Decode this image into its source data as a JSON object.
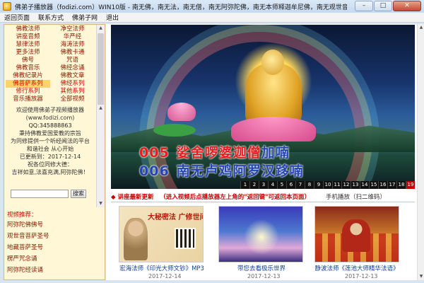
{
  "window": {
    "title": "佛弟子播放器（fodizi.com）WIN10版 - 南无佛，南无法，南无僧，南无阿弥陀佛，南无本师释迦牟尼佛，南无观世音菩萨！",
    "minimize": "–",
    "maximize": "□",
    "close": "✕"
  },
  "menu": [
    "返回页面",
    "联系方式",
    "佛弟子网",
    "退出"
  ],
  "categories": [
    [
      "佛教法师",
      "净空法师"
    ],
    [
      "讲座音频",
      "华严经"
    ],
    [
      "慧律法师",
      "海涛法师"
    ],
    [
      "更多法师",
      "佛教卡通"
    ],
    [
      "佛号",
      "咒语"
    ],
    [
      "佛教音乐",
      "佛经念诵"
    ],
    [
      "佛教纪录片",
      "佛教文章"
    ],
    [
      "佛菩萨系列",
      "佛经系列"
    ],
    [
      "修行系列",
      "其他系列"
    ],
    [
      "音乐播放器",
      "全部视频"
    ]
  ],
  "welcome": {
    "lines": [
      "欢迎使用佛弟子视频播放器",
      "(www.fodizi.com)",
      "QQ:345888863",
      "秉持佛教爱国爱教的宗旨",
      "为同修提供一个听经闻法的平台",
      "和谐社会 从心开始",
      "已更新到：2017-12-14",
      "祝各位同修大德：",
      "吉祥如意,法喜充满,阿弥陀佛！"
    ]
  },
  "search": {
    "value": "",
    "button": "搜索"
  },
  "videos": {
    "title": "视频推荐：",
    "items": [
      "阿弥陀佛佛号",
      "观世音菩萨圣号",
      "地藏菩萨圣号",
      "楞严咒念诵",
      "阿弥陀经读诵"
    ]
  },
  "banner": {
    "line1_num": "005",
    "line1_sung": "娑舍啰婆迦僧",
    "line1_rest": "加喃",
    "line2_num": "006",
    "line2_text": "南无卢鸡阿罗汉跢喃",
    "pages": [
      "1",
      "2",
      "3",
      "4",
      "5",
      "6",
      "7",
      "8",
      "9",
      "10",
      "11",
      "12",
      "13",
      "14",
      "15",
      "16",
      "17",
      "18",
      "19"
    ],
    "active_page": "19"
  },
  "news": {
    "label": "◆ 讲座最新更新",
    "tip": "（进入视频后点播放器左上角的\"返回键\"可返回本页面）",
    "mobile": "手机播放（扫二维码）"
  },
  "thumbs": [
    {
      "overlay": "大秘密法 广修世间",
      "caption": "宏海法师《印光大师文钞》MP3",
      "date": "2017-12-14"
    },
    {
      "caption": "带您去看极乐世界",
      "date": "2017-12-13"
    },
    {
      "caption": "静波法师《莲池大师精华法语》",
      "date": "2017-12-13"
    }
  ]
}
